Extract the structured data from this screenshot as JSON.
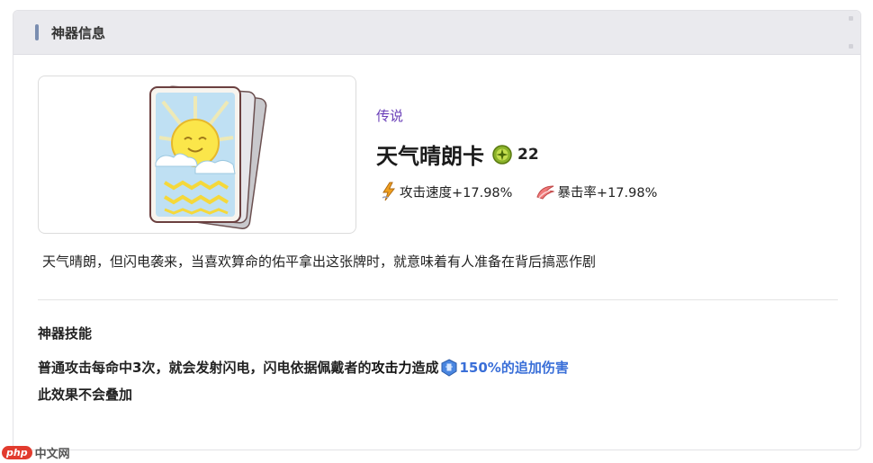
{
  "panel": {
    "title": "神器信息"
  },
  "artifact": {
    "rarity": "传说",
    "name": "天气晴朗卡",
    "level": "22",
    "stats": [
      {
        "label": "攻击速度+17.98%",
        "icon": "attack-speed-icon"
      },
      {
        "label": "暴击率+17.98%",
        "icon": "crit-rate-icon"
      }
    ],
    "description": "天气晴朗，但闪电袭来，当喜欢算命的佑平拿出这张牌时，就意味着有人准备在背后搞恶作剧"
  },
  "skill": {
    "title": "神器技能",
    "line1_prefix": "普通攻击每命中3次，就会发射闪电，闪电依据佩戴者的",
    "line1_keyword": "攻击力",
    "line1_mid": "造成",
    "line1_damage": "150%的追加伤害",
    "line2": "此效果不会叠加"
  },
  "watermark": {
    "logo": "php",
    "text": "中文网"
  },
  "colors": {
    "rarity": "#6a3fb8",
    "damage": "#3a6fd8",
    "header_bar": "#7a8db0"
  }
}
